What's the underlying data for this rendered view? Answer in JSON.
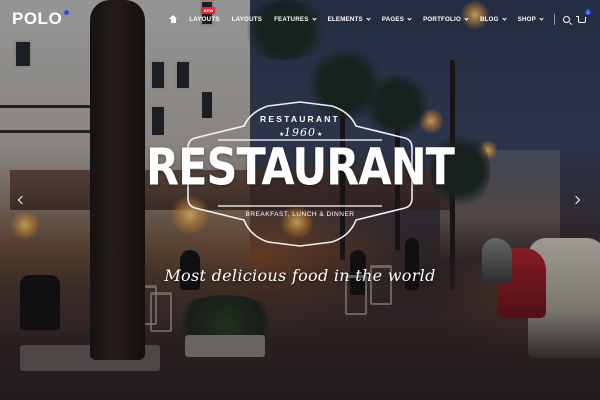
{
  "header": {
    "logo_text": "POLO",
    "accent_color": "#2250fc",
    "nav": [
      {
        "label": "Layouts",
        "badge": "NEW"
      },
      {
        "label": "Layouts"
      },
      {
        "label": "Features"
      },
      {
        "label": "Elements"
      },
      {
        "label": "Pages"
      },
      {
        "label": "Portfolio"
      },
      {
        "label": "Blog"
      },
      {
        "label": "Shop"
      }
    ],
    "cart_count": "0",
    "icons": [
      "home-icon",
      "search-icon",
      "cart-icon",
      "chevron-down-icon"
    ]
  },
  "hero": {
    "emblem_top": "RESTAURANT",
    "year": "1960",
    "title": "RESTAURANT",
    "subtitle": "BREAKFAST, LUNCH & DINNER",
    "tagline": "Most delicious food in the world",
    "arrows": [
      "chevron-left-icon",
      "chevron-right-icon"
    ]
  }
}
